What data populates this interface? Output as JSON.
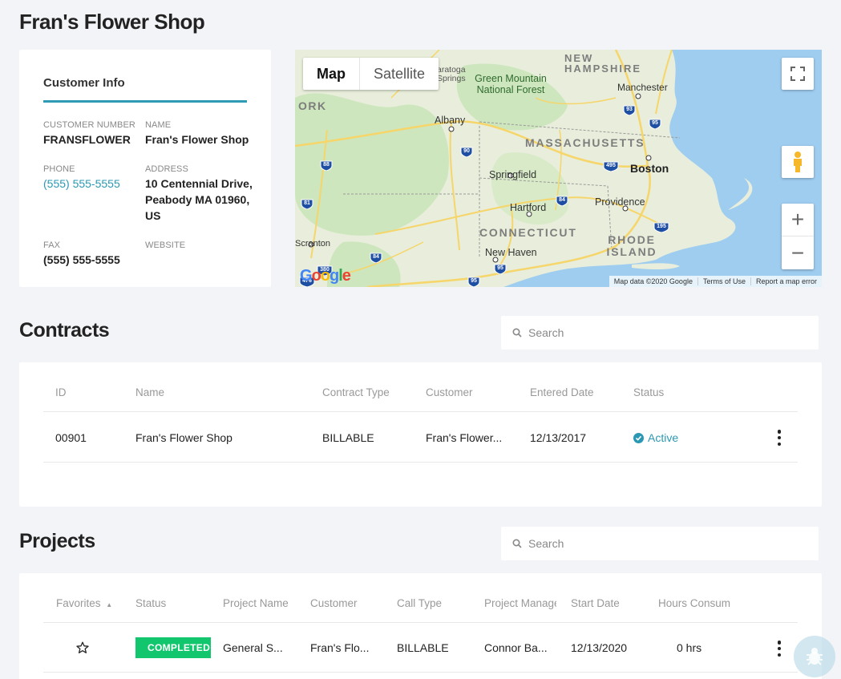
{
  "page": {
    "title": "Fran's Flower Shop"
  },
  "customer_info": {
    "heading": "Customer Info",
    "customer_number_label": "CUSTOMER NUMBER",
    "customer_number": "FRANSFLOWER",
    "name_label": "NAME",
    "name": "Fran's Flower Shop",
    "phone_label": "PHONE",
    "phone": "(555) 555-5555",
    "address_label": "ADDRESS",
    "address": "10 Centennial Drive, Peabody MA 01960, US",
    "fax_label": "FAX",
    "fax": "(555) 555-5555",
    "website_label": "WEBSITE",
    "website": ""
  },
  "map": {
    "type_buttons": [
      "Map",
      "Satellite"
    ],
    "labels": {
      "new_hampshire": "NEW HAMPSHIRE",
      "massachusetts": "MASSACHUSETTS",
      "connecticut": "CONNECTICUT",
      "rhode_island": "RHODE ISLAND",
      "york": "ORK",
      "green_mountain": "Green Mountain National Forest",
      "saratoga": "aratoga Springs",
      "manchester": "Manchester",
      "albany": "Albany",
      "boston": "Boston",
      "springfield": "Springfield",
      "hartford": "Hartford",
      "providence": "Providence",
      "new_haven": "New Haven",
      "scranton": "Scranton"
    },
    "highways": [
      "93",
      "95",
      "90",
      "88",
      "495",
      "84",
      "81",
      "84",
      "195",
      "95",
      "380",
      "476",
      "95"
    ],
    "footer": [
      "Map data ©2020 Google",
      "Terms of Use",
      "Report a map error"
    ],
    "logo": "Google",
    "colors": {
      "water": "#9fcdf0",
      "land": "#e8eedb",
      "forest": "#c6e3b5",
      "road": "#f6d56a"
    }
  },
  "contracts": {
    "title": "Contracts",
    "search_placeholder": "Search",
    "columns": [
      "ID",
      "Name",
      "Contract Type",
      "Customer",
      "Entered Date",
      "Status"
    ],
    "rows": [
      {
        "id": "00901",
        "name": "Fran's Flower Shop",
        "type": "BILLABLE",
        "customer": "Fran's Flower...",
        "entered": "12/13/2017",
        "status": "Active"
      }
    ]
  },
  "projects": {
    "title": "Projects",
    "search_placeholder": "Search",
    "columns": [
      "Favorites",
      "Status",
      "Project Name",
      "Customer",
      "Call Type",
      "Project Manage",
      "Start Date",
      "Hours Consum"
    ],
    "sort_indicator": "▲",
    "rows": [
      {
        "status": "COMPLETED",
        "name": "General S...",
        "customer": "Fran's Flo...",
        "call_type": "BILLABLE",
        "manager": "Connor Ba...",
        "start": "12/13/2020",
        "hours": "0 hrs"
      }
    ]
  },
  "colors": {
    "accent": "#2b98b3",
    "completed": "#12c66e",
    "background": "#f3f4f8"
  }
}
